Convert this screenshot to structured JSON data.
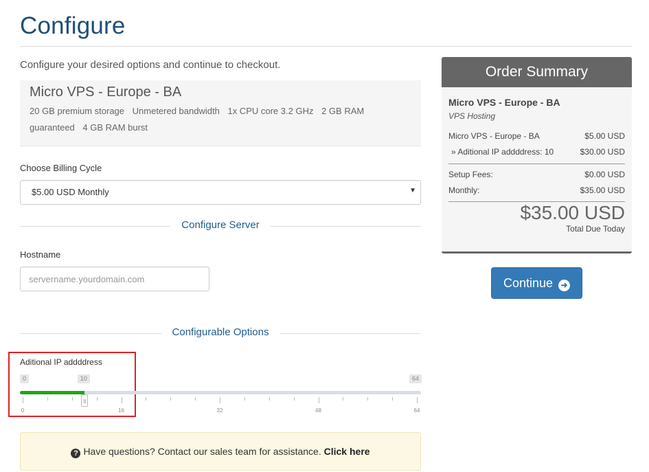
{
  "header": {
    "title": "Configure",
    "intro": "Configure your desired options and continue to checkout."
  },
  "product": {
    "name": "Micro VPS - Europe - BA",
    "features": [
      "20 GB premium storage",
      "Unmetered bandwidth",
      "1x CPU core 3.2 GHz",
      "2 GB RAM guaranteed",
      "4 GB RAM burst"
    ]
  },
  "billing": {
    "label": "Choose Billing Cycle",
    "selected": "$5.00 USD Monthly"
  },
  "configure_server": {
    "section_title": "Configure Server",
    "hostname_label": "Hostname",
    "hostname_placeholder": "servername.yourdomain.com"
  },
  "configurable_options": {
    "section_title": "Configurable Options",
    "option_label": "Aditional IP addddress",
    "slider": {
      "min": 0,
      "max": 64,
      "value": 10,
      "min_label": "0",
      "max_label": "64",
      "value_label": "10",
      "tick_labels": [
        "0",
        "16",
        "32",
        "48",
        "64"
      ]
    }
  },
  "help": {
    "text": "Have questions? Contact our sales team for assistance.",
    "link": "Click here",
    "icon": "question-circle-icon"
  },
  "order_summary": {
    "title": "Order Summary",
    "product": "Micro VPS - Europe - BA",
    "group": "VPS Hosting",
    "lines": [
      {
        "label": "Micro VPS - Europe - BA",
        "value": "$5.00 USD"
      },
      {
        "label": "» Aditional IP addddress: 10",
        "value": "$30.00 USD"
      }
    ],
    "fees": [
      {
        "label": "Setup Fees:",
        "value": "$0.00 USD"
      },
      {
        "label": "Monthly:",
        "value": "$35.00 USD"
      }
    ],
    "total": "$35.00 USD",
    "total_label": "Total Due Today"
  },
  "actions": {
    "continue_label": "Continue",
    "continue_icon": "arrow-circle-right-icon"
  },
  "colors": {
    "accent": "#337ab7",
    "slider_fill": "#1fa51b",
    "highlight": "#e21f25"
  }
}
